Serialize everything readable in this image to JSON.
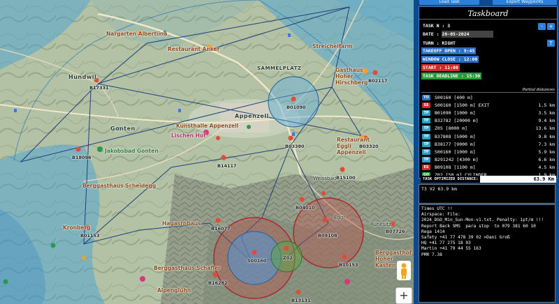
{
  "toolbar": {
    "left_button": "Load Task",
    "right_button": "Export Waypoints"
  },
  "taskboard": {
    "title": "Taskboard",
    "task_n": "TASK N : 3",
    "date_label": "DATE : ",
    "date_value": "20-05-2024",
    "turn": "TURN : RIGHT",
    "takeoff_open": "TAKEOFF OPEN : 9:45",
    "window_close": "WINDOW CLOSE : 12:00",
    "start": "START : 11:00",
    "deadline": "TASK DEADLINE : 15:30",
    "minus": "-",
    "plus": "+",
    "turn_btn": "T",
    "partial_header": "Partial distances",
    "turnpoints": [
      {
        "tag": "TO",
        "color": "#2b6fc4",
        "name": "S00160 [400 m]",
        "dist": ""
      },
      {
        "tag": "SS",
        "color": "#d02a2a",
        "name": "S00160 [1500 m] EXIT",
        "dist": "1.5 km"
      },
      {
        "tag": "TP",
        "color": "#2aa0c8",
        "name": "B01090 [1000 m]",
        "dist": "3.5 km"
      },
      {
        "tag": "TP",
        "color": "#2aa0c8",
        "name": "B32782 [20000 m]",
        "dist": "9.4 km"
      },
      {
        "tag": "TP",
        "color": "#2aa0c8",
        "name": "Z05 [8000 m]",
        "dist": "13.6 km"
      },
      {
        "tag": "TP",
        "color": "#2aa0c8",
        "name": "B37808 [5000 m]",
        "dist": "9.8 km"
      },
      {
        "tag": "TP",
        "color": "#2aa0c8",
        "name": "B38177 [9000 m]",
        "dist": "7.3 km"
      },
      {
        "tag": "TP",
        "color": "#2aa0c8",
        "name": "S00160 [1000 m]",
        "dist": "5.9 km"
      },
      {
        "tag": "TP",
        "color": "#2aa0c8",
        "name": "B291242 [4300 m]",
        "dist": "6.6 km"
      },
      {
        "tag": "ES",
        "color": "#d02a2a",
        "name": "B09108 [1100 m]",
        "dist": "4.5 km"
      },
      {
        "tag": "GO",
        "color": "#2a9a3a",
        "name": "Z02 [50 m] CYLINDER",
        "dist": "1.9 km"
      }
    ],
    "optimized_label": "TASK OPTIMIZED DISTANCE:",
    "optimized_value": "63.9 Km"
  },
  "summary_text": "T3 V2 63.9 km",
  "notes_text": "Times UTC !!\nAirspace: File:\n2024_DGO_Min_Sun-Mon-v1.txt. Penalty: 1pt/m !!!\nReport Back SMS  para stop  to 079 381 60 10\nRega 1414\nSafety +41 77 478 39 02 >Dani Groß\nHQ +41 77 275 18 03\nMartin +41 79 44 55 163\nPMR 7.38",
  "map": {
    "towns": [
      "Appenzell",
      "SAMMELPLATZ",
      "Gonten",
      "Hundwil"
    ],
    "pois": [
      "Nargarten Albertiina",
      "Restaurant Anker",
      "Gasthaus Hoher Hirschberg",
      "Kunsthalle Appenzell",
      "Lischen Hof",
      "Jakobsbad Gonten",
      "Restaurant Eggli Appenzell",
      "Berggasthaus Scheidegg",
      "Kronberg",
      "Weissbad",
      "Berggasthaus Schäfler",
      "Alpenglühn",
      "Streichelfarm",
      "Ruhesitz",
      "Berggasthof Hoher Kasten",
      "Eggi",
      "Hagasrnbaus"
    ],
    "waypoints": [
      "B17331",
      "B02117",
      "B01090",
      "B03380",
      "B03320",
      "B14117",
      "B18096",
      "B15100",
      "B04010",
      "B09108",
      "B07726",
      "B16077",
      "B01153",
      "S00160",
      "Z02",
      "B10153",
      "B16282",
      "B13131"
    ],
    "zoom_plus": "+"
  }
}
